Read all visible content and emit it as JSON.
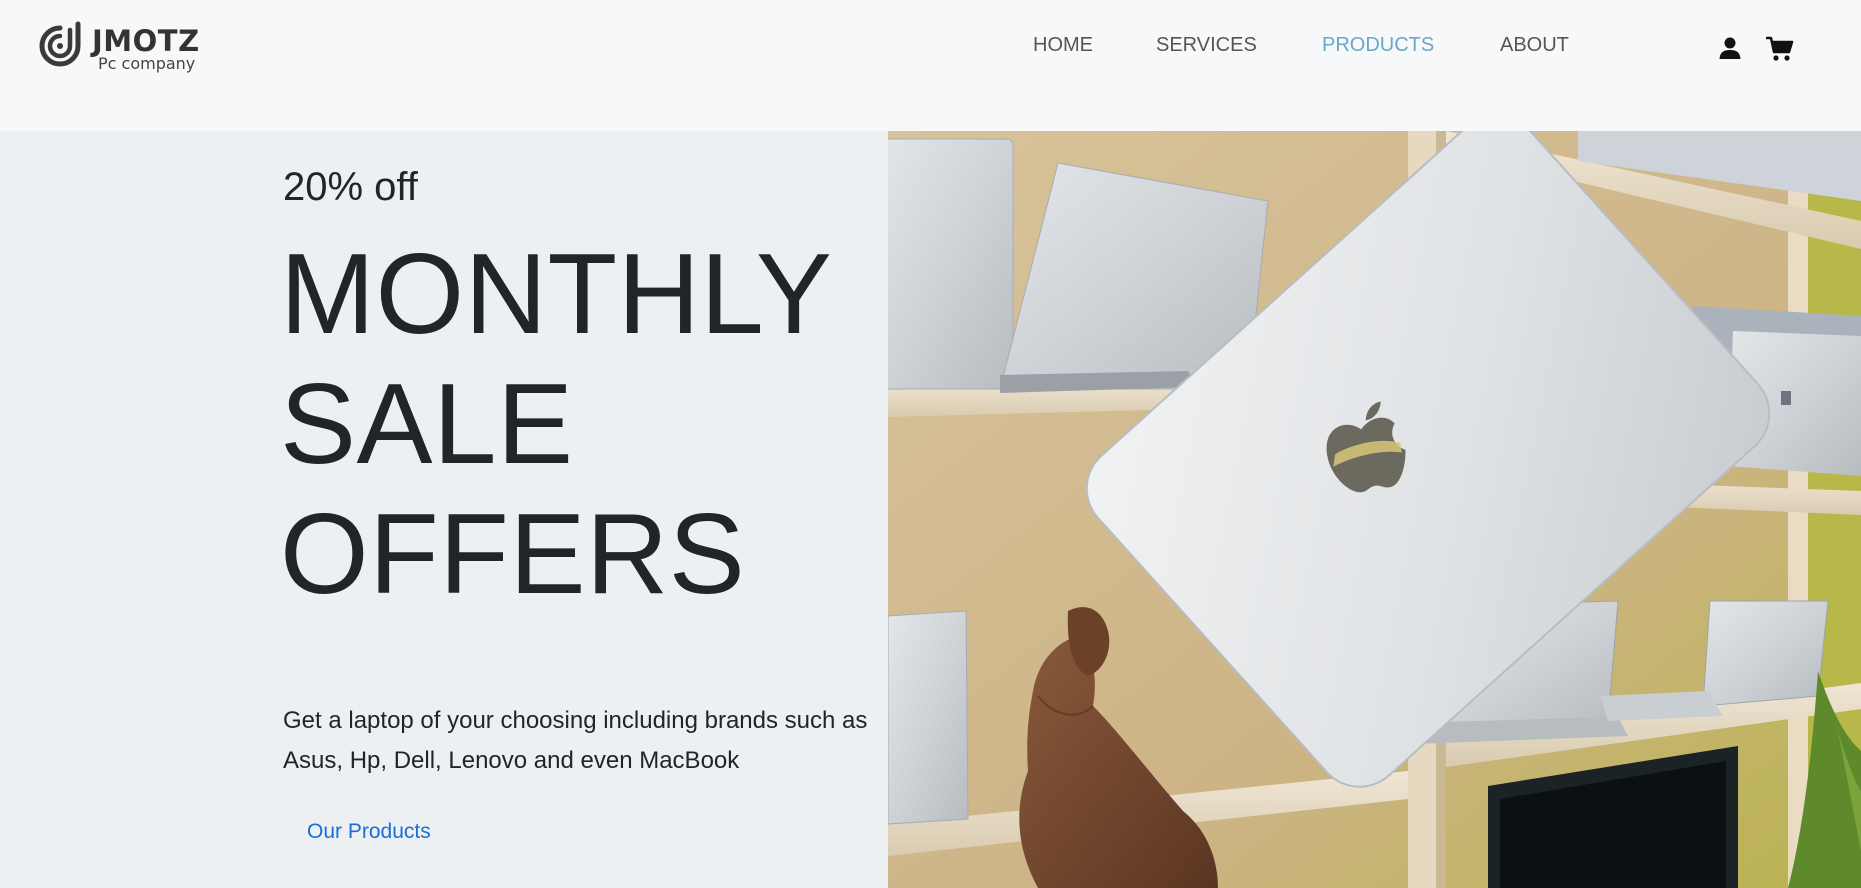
{
  "brand": {
    "name": "JMOTZ",
    "tagline": "Pc company"
  },
  "nav": {
    "items": [
      {
        "label": "HOME",
        "active": false
      },
      {
        "label": "SERVICES",
        "active": false
      },
      {
        "label": "PRODUCTS",
        "active": true
      },
      {
        "label": "ABOUT",
        "active": false
      }
    ],
    "account_icon": "user-icon",
    "cart_icon": "cart-icon"
  },
  "hero": {
    "discount": "20% off",
    "headline": [
      "MONTHLY",
      "SALE",
      "OFFERS"
    ],
    "description": "Get a laptop of your choosing including brands such as Asus, Hp, Dell, Lenovo and even MacBook",
    "cta_label": "Our Products",
    "image_subject": "hand holding a silver MacBook in front of shelves of laptops"
  },
  "colors": {
    "active_nav": "#6aa7c8",
    "link": "#1a6fd4",
    "text": "#212529",
    "hero_bg": "#edf0f3",
    "header_bg": "#f7f8fa"
  }
}
